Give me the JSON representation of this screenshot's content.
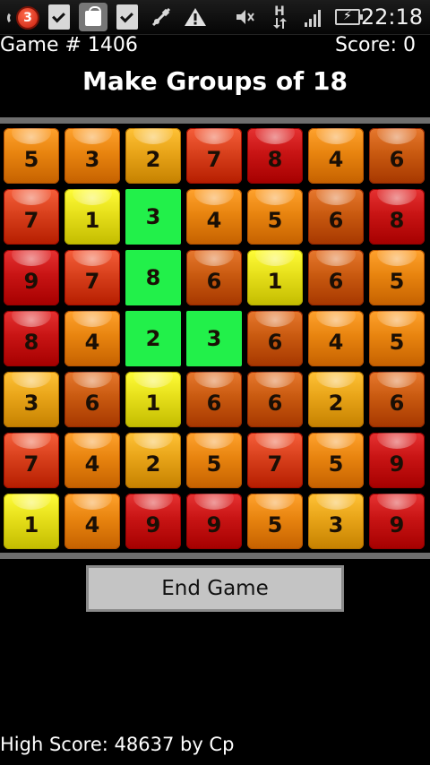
{
  "status_bar": {
    "notification_count": "3",
    "time": "22:18",
    "network_label": "H",
    "icons": [
      "notification-badge-icon",
      "download-done-icon",
      "shopping-bag-icon",
      "download-done-icon",
      "usb-debug-icon",
      "warning-icon",
      "mute-icon",
      "network-h-icon",
      "signal-icon",
      "battery-charging-icon"
    ]
  },
  "header": {
    "game_number": "Game # 1406",
    "score": "Score: 0"
  },
  "title": "Make Groups of 18",
  "board": {
    "columns": 7,
    "rows": 7,
    "colors": {
      "yellow": "#e6df1a",
      "gold": "#e8a418",
      "orange": "#e8840f",
      "dark_orange": "#c95a10",
      "red_orange": "#d8401c",
      "red": "#c81414",
      "green": "#22f04a"
    },
    "cells": [
      [
        {
          "v": "5",
          "c": "orange"
        },
        {
          "v": "3",
          "c": "orange"
        },
        {
          "v": "2",
          "c": "gold"
        },
        {
          "v": "7",
          "c": "red_orange"
        },
        {
          "v": "8",
          "c": "red"
        },
        {
          "v": "4",
          "c": "orange"
        },
        {
          "v": "6",
          "c": "dark_orange"
        }
      ],
      [
        {
          "v": "7",
          "c": "red_orange"
        },
        {
          "v": "1",
          "c": "yellow"
        },
        {
          "v": "3",
          "c": "green"
        },
        {
          "v": "4",
          "c": "orange"
        },
        {
          "v": "5",
          "c": "orange"
        },
        {
          "v": "6",
          "c": "dark_orange"
        },
        {
          "v": "8",
          "c": "red"
        }
      ],
      [
        {
          "v": "9",
          "c": "red"
        },
        {
          "v": "7",
          "c": "red_orange"
        },
        {
          "v": "8",
          "c": "green"
        },
        {
          "v": "6",
          "c": "dark_orange"
        },
        {
          "v": "1",
          "c": "yellow"
        },
        {
          "v": "6",
          "c": "dark_orange"
        },
        {
          "v": "5",
          "c": "orange"
        }
      ],
      [
        {
          "v": "8",
          "c": "red"
        },
        {
          "v": "4",
          "c": "orange"
        },
        {
          "v": "2",
          "c": "green"
        },
        {
          "v": "3",
          "c": "green"
        },
        {
          "v": "6",
          "c": "dark_orange"
        },
        {
          "v": "4",
          "c": "orange"
        },
        {
          "v": "5",
          "c": "orange"
        }
      ],
      [
        {
          "v": "3",
          "c": "gold"
        },
        {
          "v": "6",
          "c": "dark_orange"
        },
        {
          "v": "1",
          "c": "yellow"
        },
        {
          "v": "6",
          "c": "dark_orange"
        },
        {
          "v": "6",
          "c": "dark_orange"
        },
        {
          "v": "2",
          "c": "gold"
        },
        {
          "v": "6",
          "c": "dark_orange"
        }
      ],
      [
        {
          "v": "7",
          "c": "red_orange"
        },
        {
          "v": "4",
          "c": "orange"
        },
        {
          "v": "2",
          "c": "gold"
        },
        {
          "v": "5",
          "c": "orange"
        },
        {
          "v": "7",
          "c": "red_orange"
        },
        {
          "v": "5",
          "c": "orange"
        },
        {
          "v": "9",
          "c": "red"
        }
      ],
      [
        {
          "v": "1",
          "c": "yellow"
        },
        {
          "v": "4",
          "c": "orange"
        },
        {
          "v": "9",
          "c": "red"
        },
        {
          "v": "9",
          "c": "red"
        },
        {
          "v": "5",
          "c": "orange"
        },
        {
          "v": "3",
          "c": "gold"
        },
        {
          "v": "9",
          "c": "red"
        }
      ]
    ]
  },
  "end_button_label": "End Game",
  "high_score": "High Score: 48637 by Cp"
}
